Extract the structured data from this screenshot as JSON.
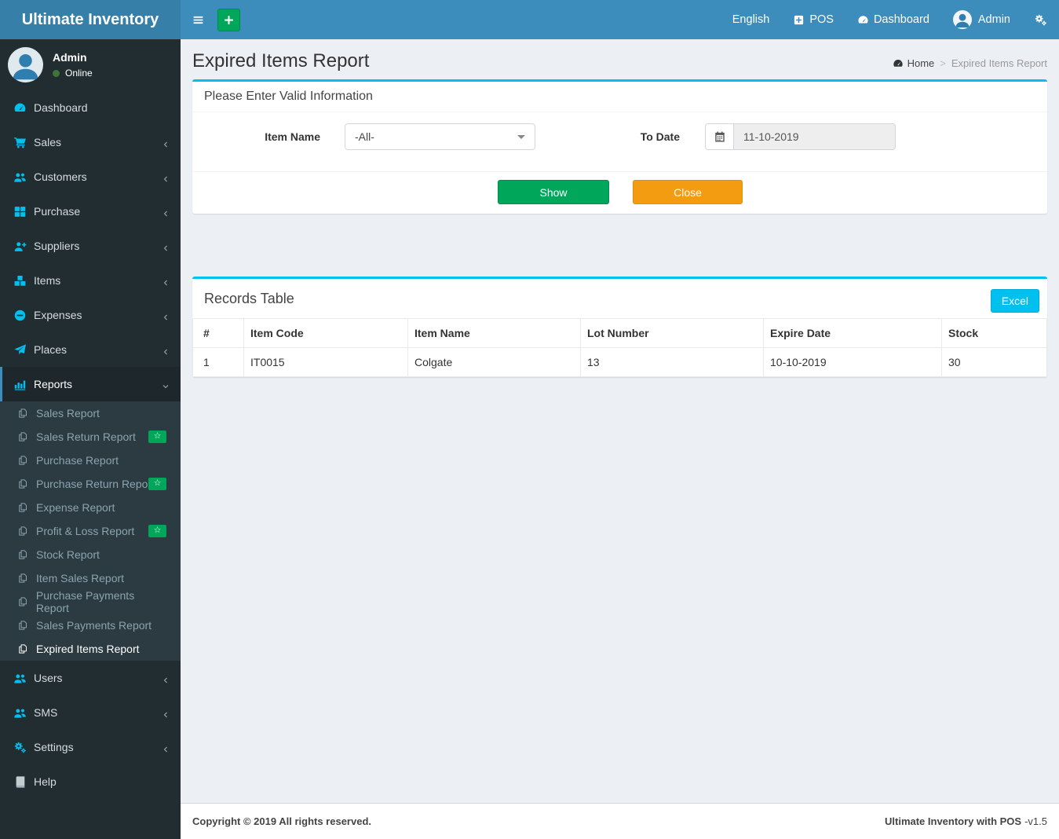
{
  "app": {
    "title": "Ultimate Inventory",
    "footer_left": "Copyright © 2019 All rights reserved.",
    "footer_right_brand": "Ultimate Inventory with POS",
    "footer_right_version": "-v1.5"
  },
  "colors": {
    "navbar": "#3c8dbc",
    "logo_bg": "#367fa9",
    "sidebar_bg": "#222d32",
    "submenu_bg": "#2c3b41",
    "accent_cyan": "#00c0ef",
    "green": "#00a65a",
    "orange": "#f39c12",
    "content_bg": "#ecf0f5"
  },
  "user_panel": {
    "name": "Admin",
    "status": "Online"
  },
  "navbar": {
    "menu_toggle_icon": "hamburger-icon",
    "add_button_icon": "plus-icon",
    "items": [
      {
        "label": "English",
        "icon": ""
      },
      {
        "label": "POS",
        "icon": "plus-square-icon"
      },
      {
        "label": "Dashboard",
        "icon": "tachometer-icon"
      },
      {
        "label": "Admin",
        "icon": "avatar-icon"
      },
      {
        "label": "",
        "icon": "gears-icon"
      }
    ]
  },
  "sidebar": {
    "items": [
      {
        "label": "Dashboard",
        "icon": "tachometer-icon",
        "chevron": ""
      },
      {
        "label": "Sales",
        "icon": "cart-icon",
        "chevron": "left"
      },
      {
        "label": "Customers",
        "icon": "users-icon",
        "chevron": "left"
      },
      {
        "label": "Purchase",
        "icon": "grid-icon",
        "chevron": "left"
      },
      {
        "label": "Suppliers",
        "icon": "user-plus-icon",
        "chevron": "left"
      },
      {
        "label": "Items",
        "icon": "cubes-icon",
        "chevron": "left"
      },
      {
        "label": "Expenses",
        "icon": "minus-circle-icon",
        "chevron": "left"
      },
      {
        "label": "Places",
        "icon": "paper-plane-icon",
        "chevron": "left"
      },
      {
        "label": "Reports",
        "icon": "bar-chart-icon",
        "chevron": "down",
        "active": true,
        "submenu": [
          {
            "label": "Sales Report",
            "icon": "files-icon"
          },
          {
            "label": "Sales Return Report",
            "icon": "files-icon",
            "badge": "star"
          },
          {
            "label": "Purchase Report",
            "icon": "files-icon"
          },
          {
            "label": "Purchase Return Report",
            "icon": "files-icon",
            "badge": "star"
          },
          {
            "label": "Expense Report",
            "icon": "files-icon"
          },
          {
            "label": "Profit & Loss Report",
            "icon": "files-icon",
            "badge": "star"
          },
          {
            "label": "Stock Report",
            "icon": "files-icon"
          },
          {
            "label": "Item Sales Report",
            "icon": "files-icon"
          },
          {
            "label": "Purchase Payments Report",
            "icon": "files-icon"
          },
          {
            "label": "Sales Payments Report",
            "icon": "files-icon"
          },
          {
            "label": "Expired Items Report",
            "icon": "files-icon",
            "active": true
          }
        ]
      },
      {
        "label": "Users",
        "icon": "users-icon",
        "chevron": "left"
      },
      {
        "label": "SMS",
        "icon": "users-icon",
        "chevron": "left"
      },
      {
        "label": "Settings",
        "icon": "gears-icon",
        "chevron": "left"
      },
      {
        "label": "Help",
        "icon": "book-icon",
        "chevron": ""
      }
    ]
  },
  "page": {
    "title": "Expired Items Report",
    "breadcrumb": {
      "home": "Home",
      "home_icon": "tachometer-icon",
      "separator": ">",
      "current": "Expired Items Report"
    }
  },
  "filter_box": {
    "heading": "Please Enter Valid Information",
    "item_name_label": "Item Name",
    "item_name_value": "-All-",
    "to_date_label": "To Date",
    "to_date_icon": "calendar-icon",
    "to_date_value": "11-10-2019",
    "show_label": "Show",
    "close_label": "Close"
  },
  "records": {
    "heading": "Records Table",
    "excel_label": "Excel",
    "columns": [
      "#",
      "Item Code",
      "Item Name",
      "Lot Number",
      "Expire Date",
      "Stock"
    ],
    "rows": [
      [
        "1",
        "IT0015",
        "Colgate",
        "13",
        "10-10-2019",
        "30"
      ]
    ]
  },
  "badge_star_glyph": "☆"
}
